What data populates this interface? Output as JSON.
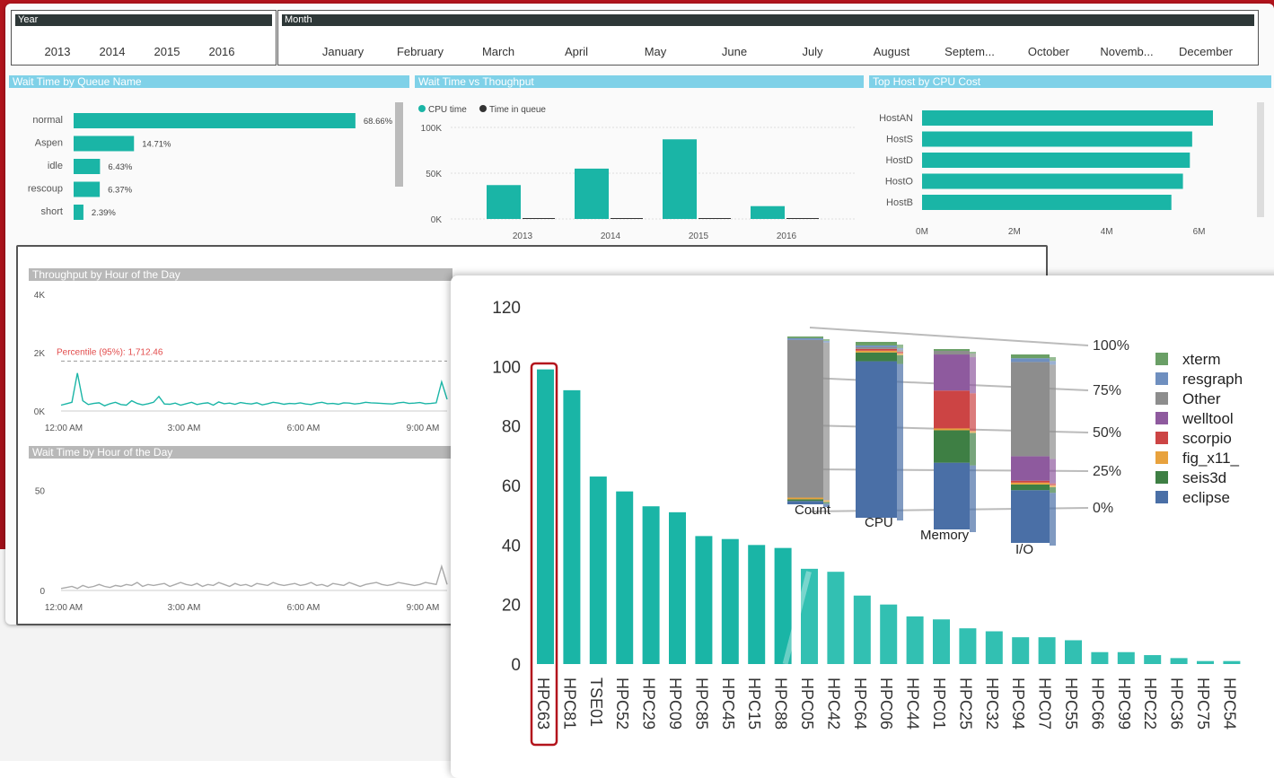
{
  "slicers": {
    "year": {
      "title": "Year",
      "items": [
        "2013",
        "2014",
        "2015",
        "2016"
      ]
    },
    "month": {
      "title": "Month",
      "items": [
        "January",
        "February",
        "March",
        "April",
        "May",
        "June",
        "July",
        "August",
        "Septem...",
        "October",
        "Novemb...",
        "December"
      ]
    }
  },
  "colors": {
    "teal": "#1ab5a6",
    "header_blue": "#7fd1e8",
    "red_bg": "#b3141c",
    "dark": "#2e3838"
  },
  "chart_data": [
    {
      "type": "bar",
      "title": "Wait Time by Queue Name",
      "orientation": "horizontal",
      "categories": [
        "normal",
        "Aspen",
        "idle",
        "rescoup",
        "short"
      ],
      "values": [
        68.66,
        14.71,
        6.43,
        6.37,
        2.39
      ],
      "labels": [
        "68.66%",
        "14.71%",
        "6.43%",
        "6.37%",
        "2.39%"
      ]
    },
    {
      "type": "bar",
      "title": "Wait Time vs Thoughput",
      "categories": [
        "2013",
        "2014",
        "2015",
        "2016"
      ],
      "series": [
        {
          "name": "CPU time",
          "values": [
            37000,
            55000,
            87000,
            14000
          ]
        },
        {
          "name": "Time in queue",
          "values": [
            500,
            500,
            500,
            500
          ]
        }
      ],
      "yticks": [
        "0K",
        "50K",
        "100K"
      ],
      "ylim": [
        0,
        110000
      ]
    },
    {
      "type": "bar",
      "title": "Top Host by CPU Cost",
      "orientation": "horizontal",
      "categories": [
        "HostAN",
        "HostS",
        "HostD",
        "HostO",
        "HostB"
      ],
      "values": [
        6300000,
        5850000,
        5800000,
        5650000,
        5400000
      ],
      "xticks": [
        "0M",
        "2M",
        "4M",
        "6M"
      ],
      "xlim": [
        0,
        7000000
      ]
    },
    {
      "type": "line",
      "title": "Throughput by Hour of the Day",
      "yticks": [
        "0K",
        "2K",
        "4K"
      ],
      "xticks": [
        "12:00 AM",
        "3:00 AM",
        "6:00 AM",
        "9:00 AM"
      ],
      "annotation": "Percentile (95%): 1,712.46",
      "values": [
        200,
        250,
        300,
        1300,
        350,
        220,
        260,
        280,
        180,
        250,
        300,
        220,
        200,
        350,
        260,
        210,
        250,
        300,
        500,
        240,
        230,
        270,
        200,
        250,
        300,
        220,
        260,
        280,
        200,
        310,
        250,
        270,
        230,
        290,
        260,
        240,
        280,
        210,
        250,
        300,
        270,
        230,
        260,
        250,
        280,
        240,
        220,
        270,
        300,
        250,
        260,
        230,
        280,
        270,
        240,
        260,
        300,
        280,
        270,
        260,
        250,
        240,
        280,
        300,
        260,
        270,
        290,
        250,
        260,
        280,
        1000,
        400
      ]
    },
    {
      "type": "line",
      "title": "Wait Time by Hour of the Day",
      "yticks": [
        "0",
        "50"
      ],
      "xticks": [
        "12:00 AM",
        "3:00 AM",
        "6:00 AM",
        "9:00 AM"
      ],
      "values": [
        1,
        1.5,
        2,
        1,
        2.5,
        1.5,
        2,
        3,
        2,
        1.5,
        2.5,
        2,
        3,
        2.5,
        4,
        2,
        3,
        2.5,
        3,
        3.5,
        2,
        3,
        4,
        3,
        2.5,
        3.5,
        2,
        3,
        2.5,
        4,
        3,
        2,
        3.5,
        2.5,
        3,
        2,
        3.5,
        3,
        2.5,
        4,
        3,
        2.5,
        3,
        3.5,
        2.5,
        3,
        4,
        2.5,
        3,
        2,
        3.5,
        3,
        2.5,
        4,
        3,
        2,
        3,
        3.5,
        4,
        3,
        2.5,
        3,
        4,
        3.5,
        3,
        2.5,
        3,
        4,
        3.5,
        3,
        12,
        3
      ]
    },
    {
      "type": "bar",
      "categories": [
        "HPC63",
        "HPC81",
        "TSE01",
        "HPC52",
        "HPC29",
        "HPC09",
        "HPC85",
        "HPC45",
        "HPC15",
        "HPC88",
        "HPC05",
        "HPC42",
        "HPC64",
        "HPC06",
        "HPC44",
        "HPC01",
        "HPC25",
        "HPC32",
        "HPC94",
        "HPC07",
        "HPC55",
        "HPC66",
        "HPC99",
        "HPC22",
        "HPC36",
        "HPC75",
        "HPC54"
      ],
      "values": [
        99,
        92,
        63,
        58,
        53,
        51,
        43,
        42,
        40,
        39,
        32,
        31,
        23,
        20,
        16,
        15,
        12,
        11,
        9,
        9,
        8,
        4,
        4,
        3,
        2,
        1,
        1
      ],
      "yticks": [
        "0",
        "20",
        "40",
        "60",
        "80",
        "100",
        "120"
      ],
      "ylim": [
        0,
        120
      ],
      "highlight": "HPC63"
    },
    {
      "type": "bar",
      "stacked": "percent",
      "categories": [
        "Count",
        "CPU",
        "Memory",
        "I/O"
      ],
      "yticks": [
        "0%",
        "25%",
        "50%",
        "75%",
        "100%"
      ],
      "series": [
        {
          "name": "xterm",
          "color": "#6a9f66",
          "values": [
            1,
            2,
            1,
            2
          ]
        },
        {
          "name": "resgraph",
          "color": "#6f8fbf",
          "values": [
            1,
            1,
            0,
            2
          ]
        },
        {
          "name": "Other",
          "color": "#8d8d8d",
          "values": [
            94,
            1,
            2,
            50
          ]
        },
        {
          "name": "welltool",
          "color": "#8e5a9e",
          "values": [
            0,
            0,
            20,
            13
          ]
        },
        {
          "name": "scorpio",
          "color": "#cc4444",
          "values": [
            0,
            1,
            21,
            1
          ]
        },
        {
          "name": "fig_x11_",
          "color": "#e8a23d",
          "values": [
            1,
            1,
            1,
            1
          ]
        },
        {
          "name": "seis3d",
          "color": "#3e7f44",
          "values": [
            1,
            5,
            18,
            3
          ]
        },
        {
          "name": "eclipse",
          "color": "#4a6fa6",
          "values": [
            2,
            89,
            37,
            28
          ]
        }
      ]
    }
  ]
}
